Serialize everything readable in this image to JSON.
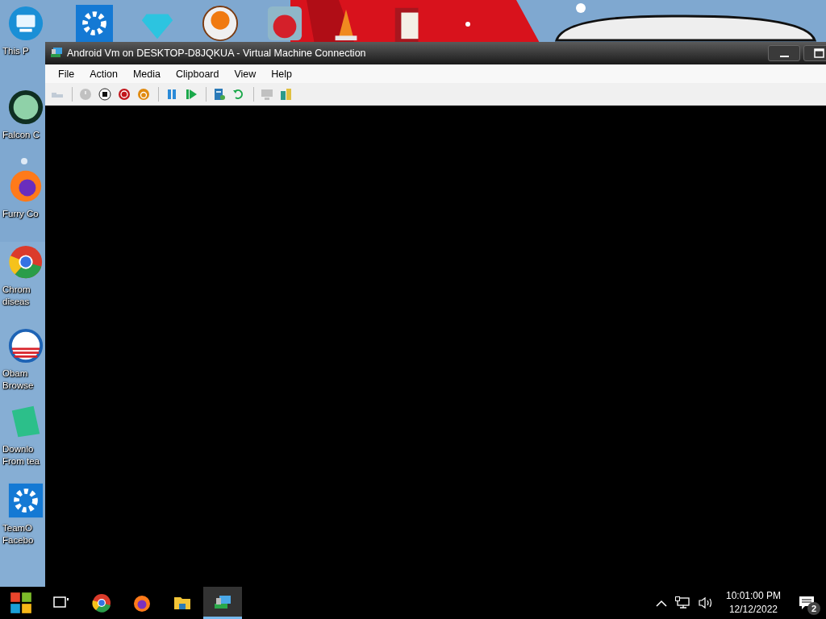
{
  "desktop": {
    "left_icons": [
      {
        "label": "This P"
      },
      {
        "label": "Falcon C"
      },
      {
        "label": "Furry Co"
      },
      {
        "label": "Chrom diseas"
      },
      {
        "label": "Obam Browse"
      },
      {
        "label": "Downlo From tea"
      },
      {
        "label": "TeamO Facebo"
      }
    ]
  },
  "window": {
    "title": "Android Vm on DESKTOP-D8JQKUA - Virtual Machine Connection",
    "menu": [
      "File",
      "Action",
      "Media",
      "Clipboard",
      "View",
      "Help"
    ],
    "toolbar": [
      {
        "disabled": true
      },
      {
        "disabled": true
      },
      {
        "disabled": false
      },
      {
        "disabled": false
      },
      {
        "disabled": false
      },
      {
        "disabled": false
      },
      {
        "disabled": false
      },
      {
        "disabled": false
      },
      {
        "disabled": false
      },
      {
        "disabled": true
      },
      {
        "disabled": false
      }
    ]
  },
  "taskbar": {
    "apps": [
      {
        "selected": false
      },
      {
        "selected": false
      },
      {
        "selected": false
      },
      {
        "selected": false
      },
      {
        "selected": true
      }
    ],
    "time": "10:01:00 PM",
    "date": "12/12/2022",
    "notifications": "2"
  }
}
